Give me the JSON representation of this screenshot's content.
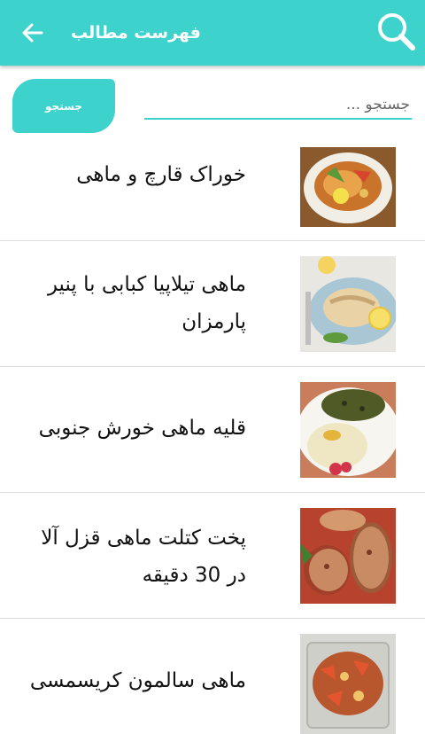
{
  "appbar": {
    "title": "فهرست مطالب",
    "back_icon": "arrow-left-icon",
    "search_icon": "search-icon",
    "color": "#3dd2cc"
  },
  "search": {
    "placeholder": "جستجو ...",
    "button_label": "جستجو"
  },
  "articles": [
    {
      "title": "خوراک قارچ و ماهی",
      "image": "fish-mushroom-dish"
    },
    {
      "title": "ماهی تیلاپیا کبابی با پنیر پارمزان",
      "image": "grilled-tilapia-parmesan"
    },
    {
      "title": "قلیه ماهی خورش جنوبی",
      "image": "ghalieh-mahi-stew"
    },
    {
      "title": "پخت کتلت ماهی قزل آلا در 30 دقیقه",
      "image": "trout-cutlet"
    },
    {
      "title": "ماهی سالمون کریسمسی",
      "image": "christmas-salmon"
    }
  ]
}
